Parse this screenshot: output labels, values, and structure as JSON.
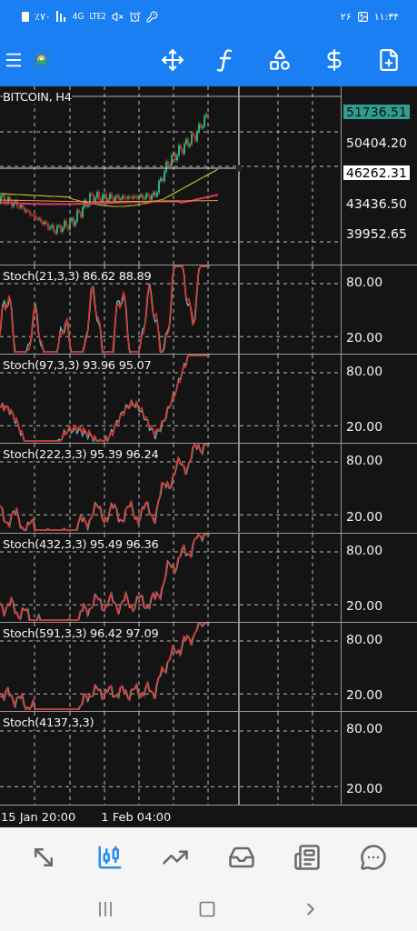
{
  "status_bar": {
    "battery": "٪۷۰",
    "network": "4G",
    "volte": "LTE2",
    "date": "۲۶",
    "time": "۱۱:۳۴"
  },
  "chart": {
    "symbol": "BITCOIN, H4",
    "price_labels": [
      {
        "text": "51736.51",
        "kind": "current"
      },
      {
        "text": "50404.20",
        "kind": "plain"
      },
      {
        "text": "46262.31",
        "kind": "crosshair"
      },
      {
        "text": "43436.50",
        "kind": "plain"
      },
      {
        "text": "39952.65",
        "kind": "plain"
      }
    ],
    "indicators": [
      {
        "label": "Stoch(21,3,3) 86.62 88.89",
        "plotted": true,
        "levels": [
          "80.00",
          "20.00"
        ]
      },
      {
        "label": "Stoch(97,3,3) 93.96 95.07",
        "plotted": true,
        "levels": [
          "80.00",
          "20.00"
        ]
      },
      {
        "label": "Stoch(222,3,3) 95.39 96.24",
        "plotted": true,
        "levels": [
          "80.00",
          "20.00"
        ]
      },
      {
        "label": "Stoch(432,3,3) 95.49 96.36",
        "plotted": true,
        "levels": [
          "80.00",
          "20.00"
        ]
      },
      {
        "label": "Stoch(591,3,3) 96.42 97.09",
        "plotted": true,
        "levels": [
          "80.00",
          "20.00"
        ]
      },
      {
        "label": "Stoch(4137,3,3)",
        "plotted": false,
        "levels": [
          "80.00",
          "20.00"
        ]
      }
    ],
    "time_labels": [
      "15 Jan 20:00",
      "1 Feb 04:00"
    ]
  },
  "bottom_nav": [
    {
      "kind": "quotes",
      "selected": false
    },
    {
      "kind": "chart",
      "selected": true
    },
    {
      "kind": "trade",
      "selected": false
    },
    {
      "kind": "history",
      "selected": false
    },
    {
      "kind": "news",
      "selected": false
    },
    {
      "kind": "chat",
      "selected": false
    }
  ]
}
